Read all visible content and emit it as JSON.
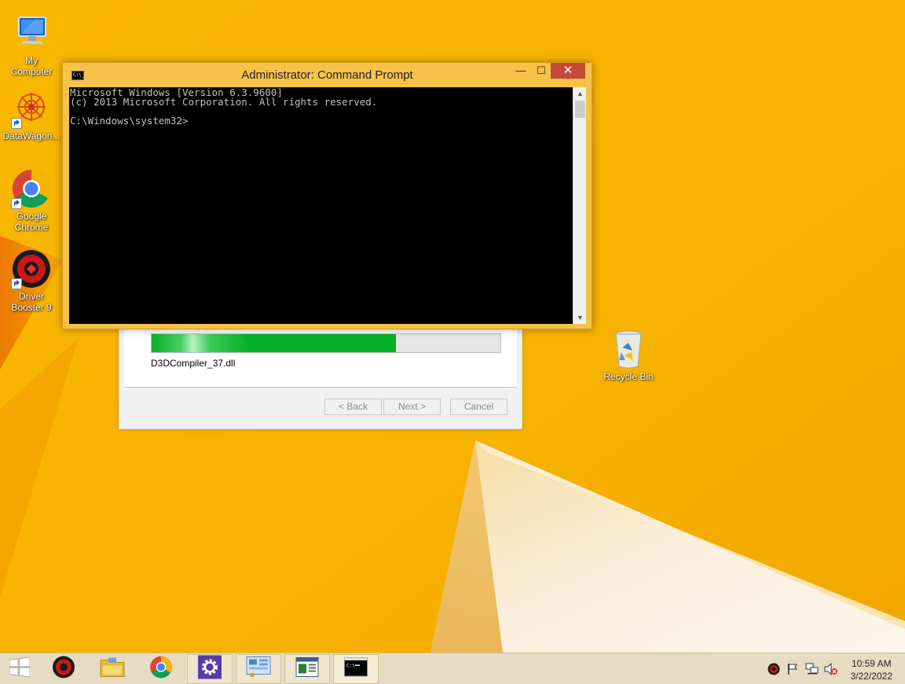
{
  "desktop": {
    "icons": [
      {
        "label_line1": "My",
        "label_line2": "Computer",
        "icon": "my-computer-icon"
      },
      {
        "label_line1": "DataWagon...",
        "label_line2": "",
        "icon": "datawagon-icon"
      },
      {
        "label_line1": "Google",
        "label_line2": "Chrome",
        "icon": "chrome-icon"
      },
      {
        "label_line1": "Driver",
        "label_line2": "Booster 9",
        "icon": "driver-booster-icon"
      }
    ],
    "recycle_bin": {
      "label": "Recycle Bin",
      "icon": "recycle-bin-icon"
    }
  },
  "wizard": {
    "progress_percent": 70,
    "current_file": "D3DCompiler_37.dll",
    "back_label": "< Back",
    "next_label": "Next >",
    "cancel_label": "Cancel"
  },
  "cmd": {
    "title": "Administrator: Command Prompt",
    "icon_text": "C:\\_",
    "minimize_glyph": "—",
    "maximize_glyph": "☐",
    "close_glyph": "✕",
    "output": "Microsoft Windows [Version 6.3.9600]\n(c) 2013 Microsoft Corporation. All rights reserved.\n\nC:\\Windows\\system32>"
  },
  "taskbar": {
    "items": [
      {
        "name": "start-button",
        "icon": "windows-logo-icon"
      },
      {
        "name": "driver-booster",
        "icon": "driver-booster-icon"
      },
      {
        "name": "file-explorer",
        "icon": "folder-icon"
      },
      {
        "name": "google-chrome",
        "icon": "chrome-icon"
      },
      {
        "name": "settings-app",
        "icon": "gear-icon"
      },
      {
        "name": "control-panel",
        "icon": "control-panel-icon"
      },
      {
        "name": "setup-window",
        "icon": "window-app-icon"
      },
      {
        "name": "command-prompt",
        "icon": "cmd-icon"
      }
    ],
    "tray_icons": [
      "driver-booster-tray-icon",
      "flag-icon",
      "network-icon",
      "volume-muted-icon"
    ],
    "time": "10:59 AM",
    "date": "3/22/2022"
  },
  "colors": {
    "wallpaper": "#f7b000",
    "cmd_frame": "#f6c24a",
    "close_button": "#c7493a",
    "progress": "#06b025"
  }
}
